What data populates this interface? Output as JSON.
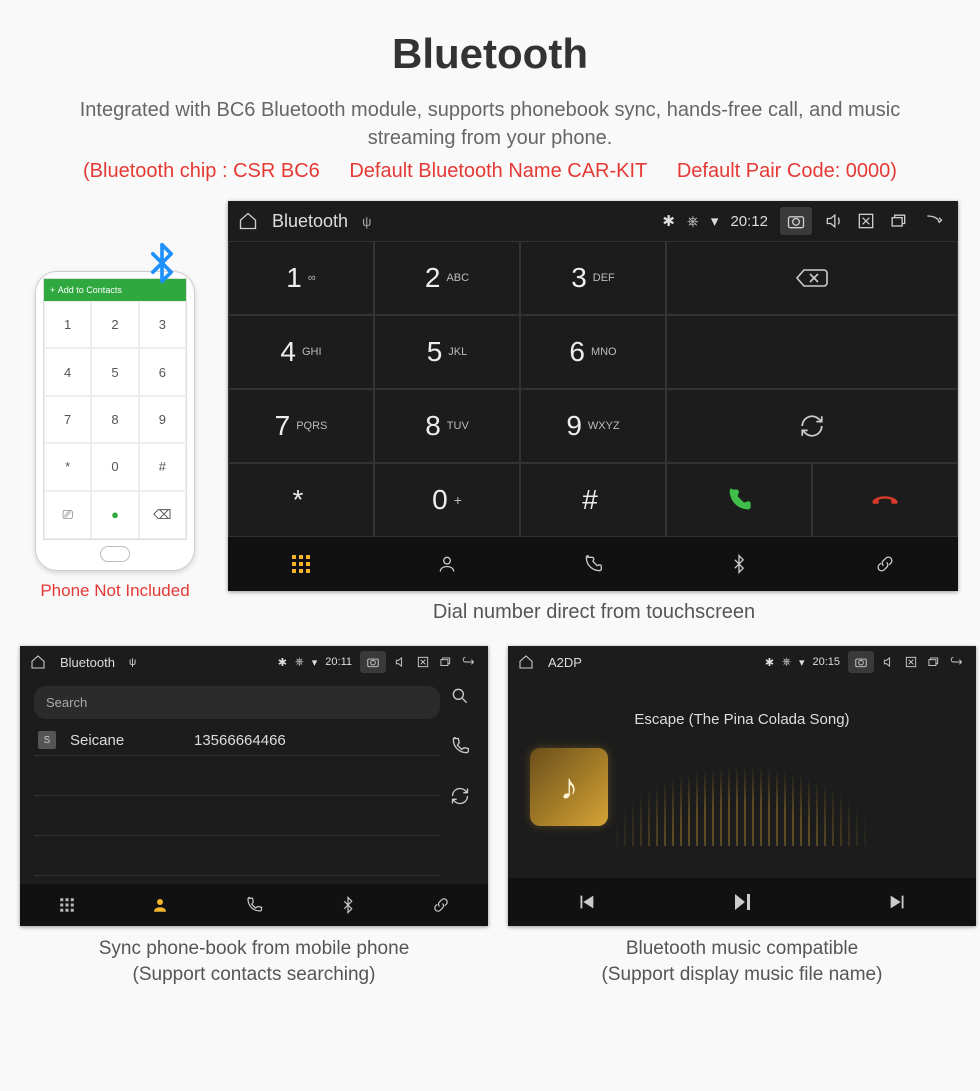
{
  "header": {
    "title": "Bluetooth",
    "description": "Integrated with BC6 Bluetooth module, supports phonebook sync, hands-free call, and music streaming from your phone.",
    "spec_chip": "(Bluetooth chip : CSR BC6",
    "spec_name": "Default Bluetooth Name CAR-KIT",
    "spec_code": "Default Pair Code: 0000)"
  },
  "phone": {
    "topbar_plus": "+",
    "topbar_label": "Add to Contacts",
    "caption": "Phone Not Included"
  },
  "dialer": {
    "status": {
      "app": "Bluetooth",
      "time": "20:12"
    },
    "keys": [
      {
        "num": "1",
        "sub": "∞"
      },
      {
        "num": "2",
        "sub": "ABC"
      },
      {
        "num": "3",
        "sub": "DEF"
      },
      {
        "num": "4",
        "sub": "GHI"
      },
      {
        "num": "5",
        "sub": "JKL"
      },
      {
        "num": "6",
        "sub": "MNO"
      },
      {
        "num": "7",
        "sub": "PQRS"
      },
      {
        "num": "8",
        "sub": "TUV"
      },
      {
        "num": "9",
        "sub": "WXYZ"
      },
      {
        "num": "*",
        "sub": ""
      },
      {
        "num": "0",
        "sub": "+"
      },
      {
        "num": "#",
        "sub": ""
      }
    ],
    "caption": "Dial number direct from touchscreen"
  },
  "phonebook": {
    "status": {
      "app": "Bluetooth",
      "time": "20:11"
    },
    "search_placeholder": "Search",
    "contact": {
      "badge": "S",
      "name": "Seicane",
      "number": "13566664466"
    },
    "caption_l1": "Sync phone-book from mobile phone",
    "caption_l2": "(Support contacts searching)"
  },
  "music": {
    "status": {
      "app": "A2DP",
      "time": "20:15"
    },
    "track": "Escape (The Pina Colada Song)",
    "caption_l1": "Bluetooth music compatible",
    "caption_l2": "(Support display music file name)"
  },
  "icons": {
    "home": "⌂",
    "usb": "ψ",
    "bt": "✱",
    "pin": "⎈",
    "wifi": "▾",
    "camera": "◎",
    "volume": "🔈",
    "close": "⛶",
    "multitask": "❐",
    "back": "↶",
    "backspace": "⌫",
    "refresh": "↻",
    "grid": "⠿",
    "person": "☺",
    "phone": "✆",
    "link": "∾",
    "search": "⌕",
    "prev": "⏮",
    "playpause": "⏯",
    "next": "⏭",
    "music_note": "♪"
  }
}
